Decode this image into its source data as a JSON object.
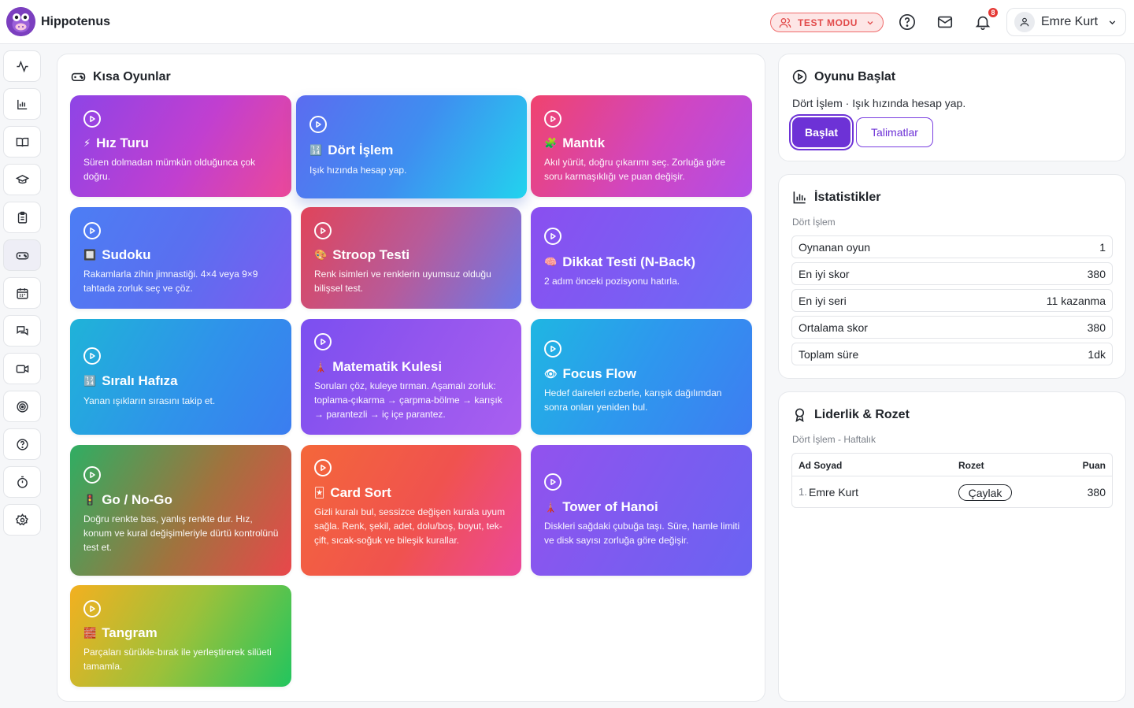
{
  "app": {
    "name": "Hippotenus",
    "test_mode_label": "TEST MODU",
    "notification_count": "8",
    "user_name": "Emre Kurt"
  },
  "sidebar": {
    "items": [
      {
        "name": "activity",
        "icon": "activity-icon"
      },
      {
        "name": "reports",
        "icon": "bar-chart-icon"
      },
      {
        "name": "library",
        "icon": "book-icon"
      },
      {
        "name": "education",
        "icon": "graduation-cap-icon"
      },
      {
        "name": "tasks",
        "icon": "clipboard-icon"
      },
      {
        "name": "games",
        "icon": "gamepad-icon",
        "active": true
      },
      {
        "name": "calendar",
        "icon": "calendar-icon"
      },
      {
        "name": "messages",
        "icon": "chat-icon"
      },
      {
        "name": "video",
        "icon": "video-icon"
      },
      {
        "name": "targets",
        "icon": "target-icon"
      },
      {
        "name": "help",
        "icon": "help-icon"
      },
      {
        "name": "timer",
        "icon": "timer-icon"
      },
      {
        "name": "settings",
        "icon": "gear-icon"
      }
    ]
  },
  "games_panel": {
    "title": "Kısa Oyunlar",
    "cards": [
      {
        "emoji": "⚡",
        "title": "Hız Turu",
        "desc": "Süren dolmadan mümkün olduğunca çok doğru."
      },
      {
        "emoji": "🔢",
        "title": "Dört İşlem",
        "desc": "Işık hızında hesap yap."
      },
      {
        "emoji": "🧩",
        "title": "Mantık",
        "desc": "Akıl yürüt, doğru çıkarımı seç. Zorluğa göre soru karmaşıklığı ve puan değişir."
      },
      {
        "emoji": "🔲",
        "title": "Sudoku",
        "desc": "Rakamlarla zihin jimnastiği. 4×4 veya 9×9 tahtada zorluk seç ve çöz."
      },
      {
        "emoji": "🎨",
        "title": "Stroop Testi",
        "desc": "Renk isimleri ve renklerin uyumsuz olduğu bilişsel test."
      },
      {
        "emoji": "🧠",
        "title": "Dikkat Testi (N-Back)",
        "desc": "2 adım önceki pozisyonu hatırla."
      },
      {
        "emoji": "🔢",
        "title": "Sıralı Hafıza",
        "desc": "Yanan ışıkların sırasını takip et."
      },
      {
        "emoji": "🗼",
        "title": "Matematik Kulesi",
        "desc": "Soruları çöz, kuleye tırman. Aşamalı zorluk: toplama-çıkarma → çarpma-bölme → karışık → parantezli → iç içe parantez."
      },
      {
        "emoji": "👁",
        "title": "Focus Flow",
        "desc": "Hedef daireleri ezberle, karışık dağılımdan sonra onları yeniden bul."
      },
      {
        "emoji": "🚦",
        "title": "Go / No-Go",
        "desc": "Doğru renkte bas, yanlış renkte dur. Hız, konum ve kural değişimleriyle dürtü kontrolünü test et."
      },
      {
        "emoji": "🃏",
        "title": "Card Sort",
        "desc": "Gizli kuralı bul, sessizce değişen kurala uyum sağla. Renk, şekil, adet, dolu/boş, boyut, tek-çift, sıcak-soğuk ve bileşik kurallar."
      },
      {
        "emoji": "🗼",
        "title": "Tower of Hanoi",
        "desc": "Diskleri sağdaki çubuğa taşı. Süre, hamle limiti ve disk sayısı zorluğa göre değişir."
      },
      {
        "emoji": "🧱",
        "title": "Tangram",
        "desc": "Parçaları sürükle-bırak ile yerleştirerek silüeti tamamla."
      }
    ]
  },
  "start_panel": {
    "title": "Oyunu Başlat",
    "game_name": "Dört İşlem",
    "separator": " · ",
    "game_desc": "Işık hızında hesap yap.",
    "start_label": "Başlat",
    "instructions_label": "Talimatlar"
  },
  "stats_panel": {
    "title": "İstatistikler",
    "subtitle": "Dört İşlem",
    "rows": [
      {
        "label": "Oynanan oyun",
        "value": "1"
      },
      {
        "label": "En iyi skor",
        "value": "380"
      },
      {
        "label": "En iyi seri",
        "value": "11 kazanma"
      },
      {
        "label": "Ortalama skor",
        "value": "380"
      },
      {
        "label": "Toplam süre",
        "value": "1dk"
      }
    ]
  },
  "leaderboard_panel": {
    "title": "Liderlik & Rozet",
    "subtitle": "Dört İşlem - Haftalık",
    "headers": {
      "name": "Ad Soyad",
      "badge": "Rozet",
      "score": "Puan"
    },
    "rows": [
      {
        "rank": "1.",
        "name": "Emre Kurt",
        "badge": "Çaylak",
        "score": "380"
      }
    ]
  },
  "colors": {
    "brand_purple": "#6d32d6",
    "test_mode_red": "#e24b4b"
  }
}
